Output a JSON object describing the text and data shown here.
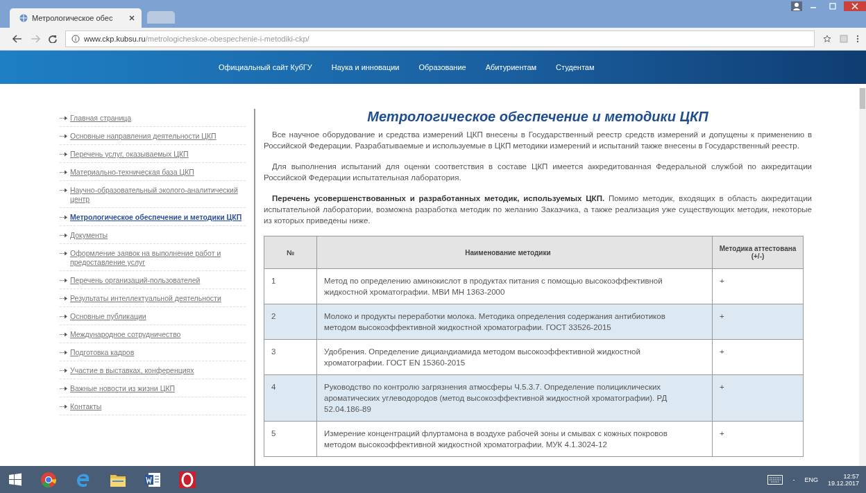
{
  "browser": {
    "tabs": [
      {
        "title": "Метрологическое обес",
        "selected": true
      },
      {
        "selected": false
      }
    ],
    "address": {
      "domain": "www.ckp.kubsu.ru",
      "path": "/metrologicheskoe-obespechenie-i-metodiki-ckp/"
    }
  },
  "nav": [
    "Официальный сайт КубГУ",
    "Наука и инновации",
    "Образование",
    "Абитуриентам",
    "Студентам"
  ],
  "sidebar": {
    "items": [
      {
        "label": "Главная страница",
        "selected": false
      },
      {
        "label": "Основные направления деятельности ЦКП",
        "selected": false
      },
      {
        "label": "Перечень услуг, оказываемых ЦКП",
        "selected": false
      },
      {
        "label": "Материально-техническая база ЦКП",
        "selected": false
      },
      {
        "label": "Научно-образовательный эколого-аналитический центр",
        "selected": false
      },
      {
        "label": "Метрологическое обеспечение и методики ЦКП",
        "selected": true
      },
      {
        "label": "Документы",
        "selected": false
      },
      {
        "label": "Оформление заявок на выполнение работ и предоставление услуг",
        "selected": false
      },
      {
        "label": "Перечень организаций-пользователей",
        "selected": false
      },
      {
        "label": "Результаты интеллектуальной деятельности",
        "selected": false
      },
      {
        "label": "Основные публикации",
        "selected": false
      },
      {
        "label": "Международное сотрудничество",
        "selected": false
      },
      {
        "label": "Подготовка кадров",
        "selected": false
      },
      {
        "label": "Участие в выставках, конференциях",
        "selected": false
      },
      {
        "label": "Важные новости из жизни ЦКП",
        "selected": false
      },
      {
        "label": "Контакты",
        "selected": false
      }
    ]
  },
  "page": {
    "title": "Метрологическое обеспечение и методики ЦКП",
    "paragraphs": [
      "Все научное оборудование и средства измерений ЦКП внесены в Государственный реестр средств измерений и допущены к применению в Российской Федерации. Разрабатываемые и используемые в ЦКП методики измерений и испытаний также внесены в Государственный реестр.",
      "Для выполнения испытаний для оценки соответствия в составе ЦКП имеется аккредитованная Федеральной службой по аккредитации Российской Федерации испытательная лаборатория.",
      "**Перечень усовершенствованных и разработанных методик, используемых ЦКП.** Помимо методик, входящих в область аккредитации испытательной лаборатории, возможна разработка методик по желанию Заказчика, а также реализация уже существующих методик, некоторые из которых приведены ниже."
    ],
    "table": {
      "columns": [
        "№",
        "Наименование методики",
        "Методика аттестована (+/-)"
      ],
      "rows": [
        {
          "number": "1",
          "name": "Метод по определению аминокислот в продуктах питания с помощью высокоэффективной жидкостной хроматографии. МВИ МН 1363-2000",
          "attested": "+"
        },
        {
          "number": "2",
          "name": "Молоко и продукты переработки молока. Методика определения содержания антибиотиков методом высокоэффективной жидкостной хроматографии. ГОСТ 33526-2015",
          "attested": "+"
        },
        {
          "number": "3",
          "name": "Удобрения. Определение дициандиамида методом высокоэффективной жидкостной хроматографии. ГОСТ EN 15360-2015",
          "attested": "+"
        },
        {
          "number": "4",
          "name": "Руководство по контролю загрязнения атмосферы Ч.5.3.7. Определение полициклических ароматических углеводородов (метод высокоэффективной жидкостной хроматографии). РД 52.04.186-89",
          "attested": "+"
        },
        {
          "number": "5",
          "name": "Измерение концентраций флуртамона в воздухе рабочей зоны и смывах с кожных покровов методом высокоэффективной жидкостной хроматографии. МУК 4.1.3024-12",
          "attested": "+"
        }
      ]
    }
  },
  "taskbar": {
    "tray_mark": "-",
    "language": "ENG",
    "time": "12:57",
    "date": "19.12.2017"
  }
}
